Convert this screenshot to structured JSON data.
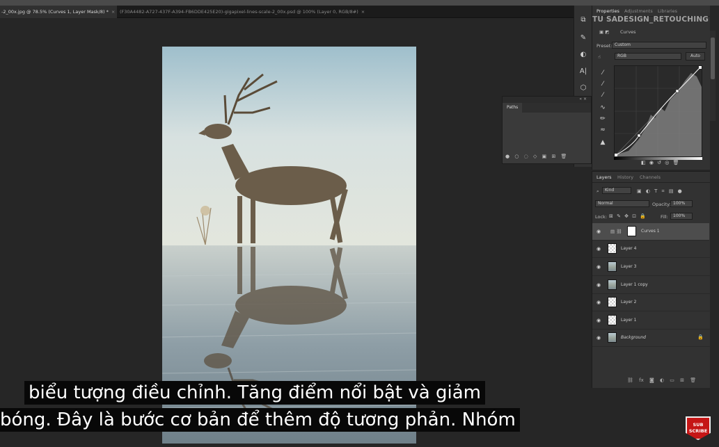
{
  "document_tabs": [
    {
      "label": "-2_00x.jpg @ 78.5% (Curves 1, Layer Mask/8) *",
      "close": "×"
    },
    {
      "label": "(F30A4482-A727-437F-A394-FB6DDE425E20)-gigapixel-lines-scale-2_00x.psd @ 100% (Layer 0, RGB/8#)",
      "close": "×"
    }
  ],
  "watermark": "TU SADESIGN_RETOUCHING",
  "properties": {
    "tabs": [
      "Properties",
      "Adjustments",
      "Libraries"
    ],
    "title": "Curves",
    "preset_label": "Preset:",
    "preset_value": "Custom",
    "channel_value": "RGB",
    "auto_button": "Auto"
  },
  "paths": {
    "tab": "Paths"
  },
  "layers_panel": {
    "tabs": [
      "Layers",
      "History",
      "Channels"
    ],
    "filter_kind": "Kind",
    "blend_mode": "Normal",
    "opacity_label": "Opacity:",
    "opacity_value": "100%",
    "lock_label": "Lock:",
    "fill_label": "Fill:",
    "fill_value": "100%",
    "layers": [
      {
        "name": "Curves 1",
        "selected": true
      },
      {
        "name": "Layer 4",
        "selected": false
      },
      {
        "name": "Layer 3",
        "selected": false
      },
      {
        "name": "Layer 1 copy",
        "selected": false
      },
      {
        "name": "Layer 2",
        "selected": false
      },
      {
        "name": "Layer 1",
        "selected": false
      },
      {
        "name": "Background",
        "selected": false
      }
    ]
  },
  "subtitles": {
    "line1": "biểu tượng điều chỉnh.  Tăng điểm nổi bật và giảm",
    "line2": "bóng.  Đây là bước cơ bản để thêm độ tương phản.  Nhóm"
  },
  "subscribe_badge": {
    "line1": "SUB",
    "line2": "SCRIBE"
  },
  "colors": {
    "panel": "#323232",
    "selected_layer": "#4d4d4d",
    "subscribe": "#c51616"
  }
}
